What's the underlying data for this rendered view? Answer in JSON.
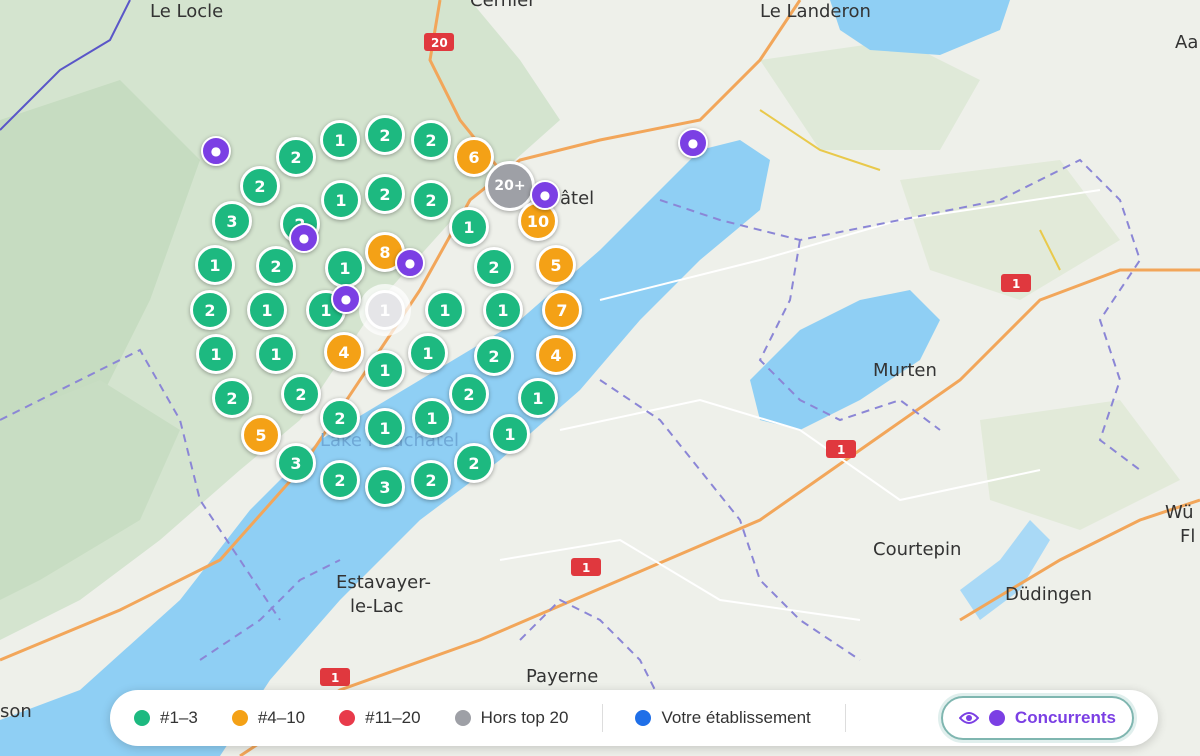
{
  "map": {
    "places": {
      "le_locle": "Le Locle",
      "le_landeron": "Le Landeron",
      "neuchatel": "âtel",
      "murten": "Murten",
      "courtepin": "Courtepin",
      "estavayer_1": "Estavayer-",
      "estavayer_2": "le-Lac",
      "dudingen": "Düdingen",
      "payerne": "Payerne",
      "aa": "Aa",
      "wu": "Wü",
      "fl": "Fl",
      "son": "son",
      "cernier": "Cernier",
      "lake": "Lake Neuchâtel"
    },
    "routes": {
      "r20": "20",
      "r1": "1"
    },
    "markers": [
      "1",
      "2",
      "2",
      "6",
      "2",
      "2",
      "1",
      "2",
      "2",
      "20+",
      "3",
      "2",
      "10",
      "1",
      "2",
      "8",
      "5",
      "1",
      "1",
      "2",
      "2",
      "1",
      "1",
      "1",
      "1",
      "7",
      "1",
      "1",
      "1",
      "4",
      "2",
      "4",
      "2",
      "2",
      "1",
      "1",
      "2",
      "5",
      "2",
      "1",
      "1",
      "1",
      "3",
      "1",
      "3",
      "2",
      "2"
    ],
    "competitor_pins": 6
  },
  "legend": {
    "items": [
      {
        "label": "#1–3",
        "color": "#1db980"
      },
      {
        "label": "#4–10",
        "color": "#f4a116"
      },
      {
        "label": "#11–20",
        "color": "#e83a4a"
      },
      {
        "label": "Hors top 20",
        "color": "#9ea0a6"
      },
      {
        "label": "Votre établissement",
        "color": "#1f6fe8"
      }
    ],
    "competitors_label": "Concurrents",
    "competitors_color": "#7b3fe4",
    "eye_icon": "eye-icon"
  }
}
